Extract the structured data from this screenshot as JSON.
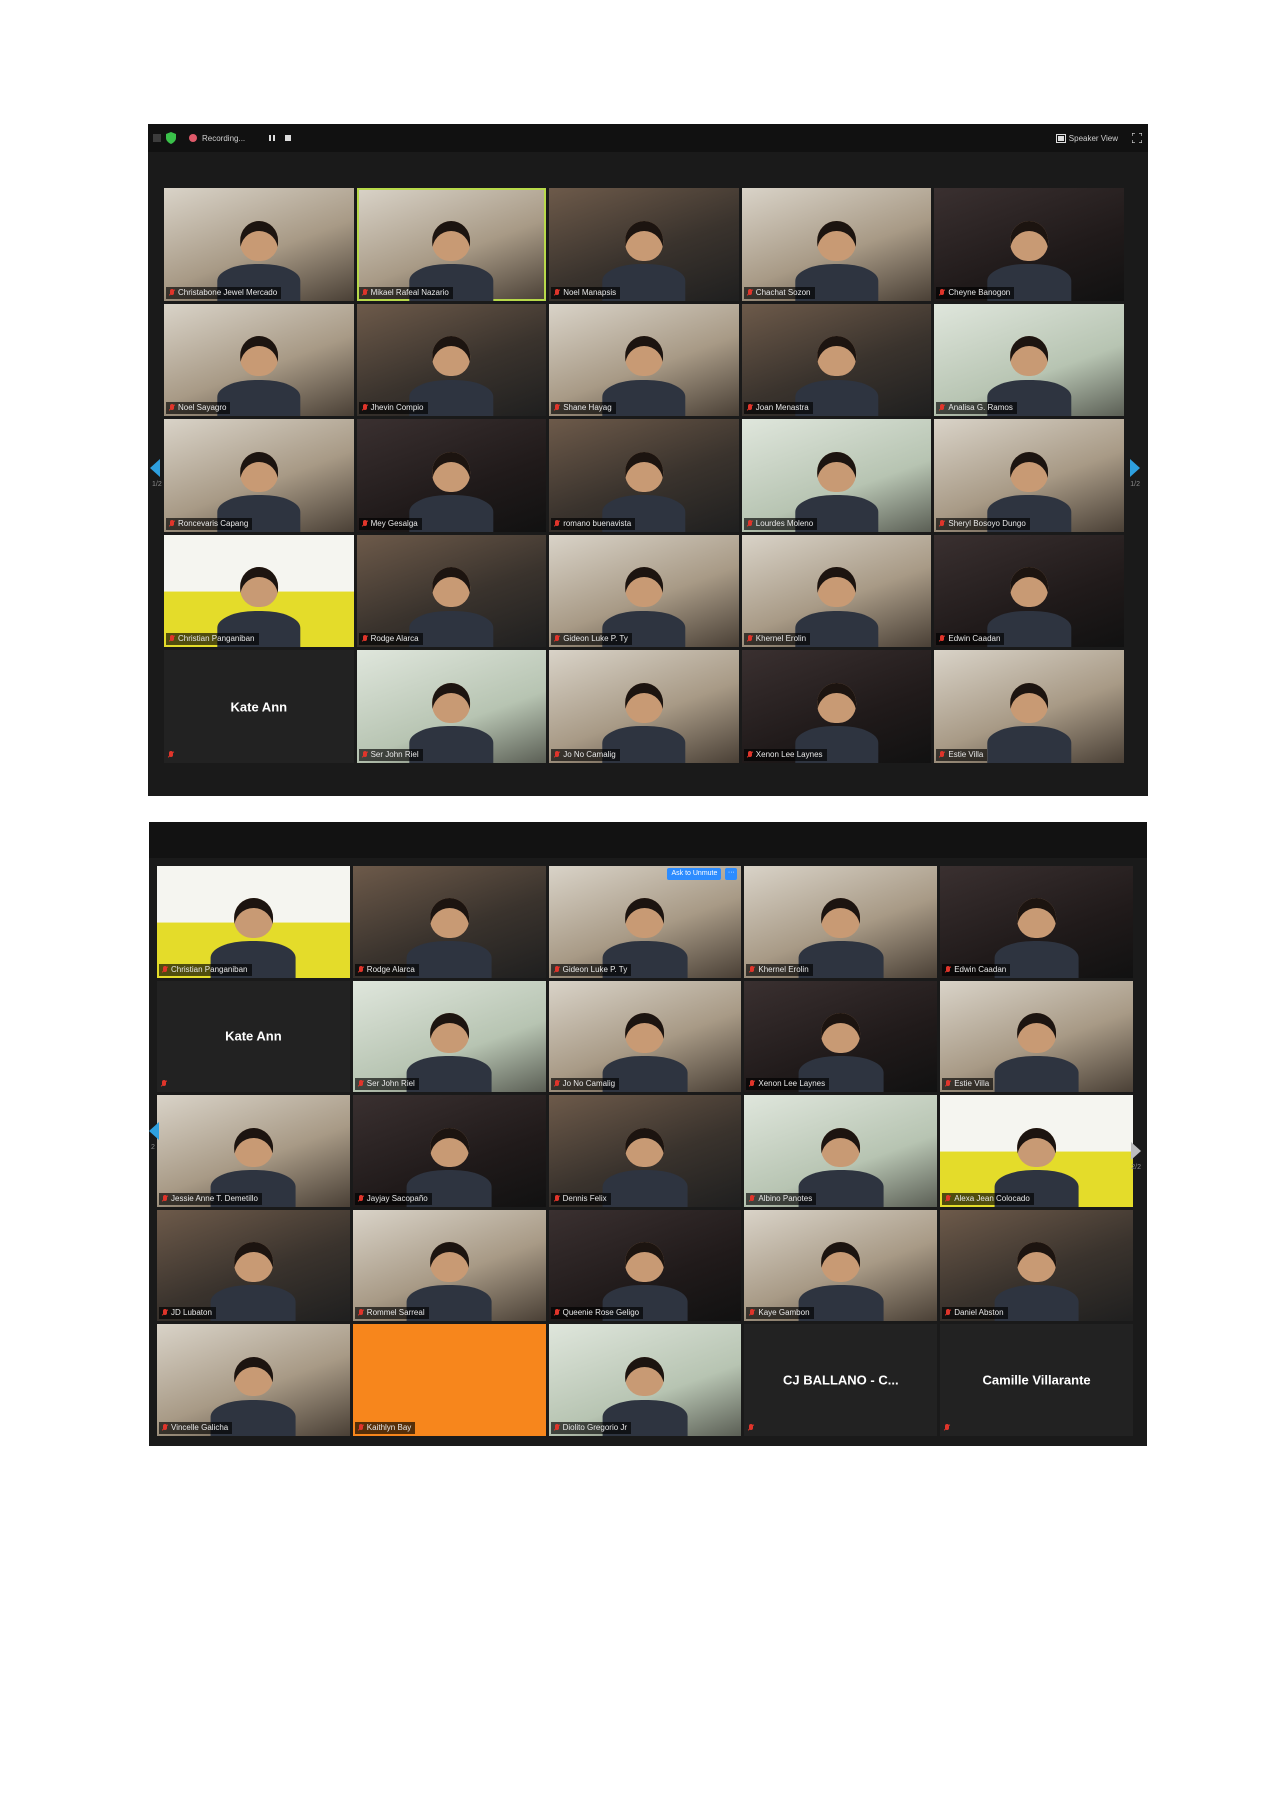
{
  "colors": {
    "zoom_bg": "#1a1a1a",
    "muted_red": "#e0352b",
    "accent_blue": "#2d8cff",
    "active_speaker": "#b8d94a",
    "orange_tile": "#f7861c"
  },
  "shot1": {
    "toolbar": {
      "recording_label": "Recording...",
      "speaker_view_label": "Speaker View"
    },
    "page_indicator_left": "1/2",
    "page_indicator_right": "1/2",
    "tiles": [
      {
        "name": "Christabone Jewel Mercado",
        "style": "light"
      },
      {
        "name": "Mikael Rafeal Nazario",
        "style": "light"
      },
      {
        "name": "Noel Manapsis",
        "style": "video"
      },
      {
        "name": "Chachat Sozon",
        "style": "light"
      },
      {
        "name": "Cheyne Banogon",
        "style": "dark"
      },
      {
        "name": "Noel Sayagro",
        "style": "light"
      },
      {
        "name": "Jhevin Compio",
        "style": "video"
      },
      {
        "name": "Shane Hayag",
        "style": "light"
      },
      {
        "name": "Joan Menastra",
        "style": "video"
      },
      {
        "name": "Analisa G. Ramos",
        "style": "green"
      },
      {
        "name": "Roncevaris Capang",
        "style": "light"
      },
      {
        "name": "Mey Gesalga",
        "style": "dark"
      },
      {
        "name": "romano buenavista",
        "style": "video"
      },
      {
        "name": "Lourdes Moleno",
        "style": "green"
      },
      {
        "name": "Sheryl Bosoyo Dungo",
        "style": "light"
      },
      {
        "name": "Christian Panganiban",
        "style": "yellow"
      },
      {
        "name": "Rodge Alarca",
        "style": "video"
      },
      {
        "name": "Gideon Luke P. Ty",
        "style": "light"
      },
      {
        "name": "Khernel Erolin",
        "style": "light"
      },
      {
        "name": "Edwin Caadan",
        "style": "dark"
      },
      {
        "name": "Kate Ann",
        "style": "name_only"
      },
      {
        "name": "Ser John Riel",
        "style": "green"
      },
      {
        "name": "Jo No Camalig",
        "style": "light"
      },
      {
        "name": "Xenon Lee Laynes",
        "style": "dark"
      },
      {
        "name": "Estie Villa",
        "style": "light"
      }
    ]
  },
  "shot2": {
    "ask_to_unmute": "Ask to Unmute",
    "more_label": "···",
    "page_indicator_left": "2",
    "page_indicator_right": "2/2",
    "tiles": [
      {
        "name": "Christian Panganiban",
        "style": "yellow"
      },
      {
        "name": "Rodge Alarca",
        "style": "video"
      },
      {
        "name": "Gideon Luke P. Ty",
        "style": "light"
      },
      {
        "name": "Khernel Erolin",
        "style": "light"
      },
      {
        "name": "Edwin Caadan",
        "style": "dark"
      },
      {
        "name": "Kate Ann",
        "style": "name_only"
      },
      {
        "name": "Ser John Riel",
        "style": "green"
      },
      {
        "name": "Jo No Camalig",
        "style": "light"
      },
      {
        "name": "Xenon Lee Laynes",
        "style": "dark"
      },
      {
        "name": "Estie Villa",
        "style": "light"
      },
      {
        "name": "Jessie Anne T. Demetillo",
        "style": "light"
      },
      {
        "name": "Jayjay Sacopaño",
        "style": "dark"
      },
      {
        "name": "Dennis Felix",
        "style": "video"
      },
      {
        "name": "Albino Panotes",
        "style": "green"
      },
      {
        "name": "Alexa Jean Colocado",
        "style": "yellow"
      },
      {
        "name": "JD Lubaton",
        "style": "video"
      },
      {
        "name": "Rommel Sarreal",
        "style": "light"
      },
      {
        "name": "Queenie Rose Geligo",
        "style": "dark"
      },
      {
        "name": "Kaye Gambon",
        "style": "light"
      },
      {
        "name": "Daniel Abston",
        "style": "video"
      },
      {
        "name": "Vincelle Galicha",
        "style": "light"
      },
      {
        "name": "Kaithlyn Bay",
        "style": "orange"
      },
      {
        "name": "Diolito Gregorio Jr",
        "style": "green"
      },
      {
        "name": "CJ BALLANO - C...",
        "style": "name_only"
      },
      {
        "name": "Camille Villarante",
        "style": "name_only"
      }
    ]
  }
}
